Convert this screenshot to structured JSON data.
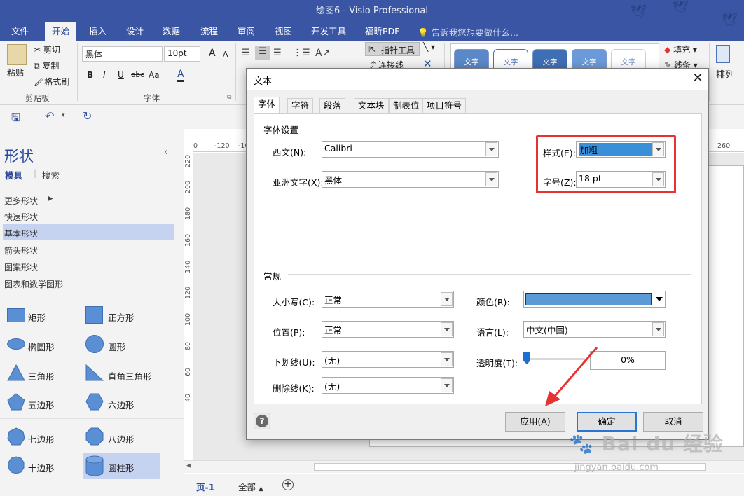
{
  "window": {
    "title": "绘图6 - Visio Professional"
  },
  "ribbon_tabs": [
    "文件",
    "开始",
    "插入",
    "设计",
    "数据",
    "流程",
    "审阅",
    "视图",
    "开发工具",
    "福昕PDF"
  ],
  "active_ribbon_tab": "开始",
  "tell_me": "告诉我您想要做什么...",
  "ribbon": {
    "paste": "粘贴",
    "cut": "剪切",
    "copy": "复制",
    "format_painter": "格式刷",
    "clipboard_label": "剪贴板",
    "font_name": "黑体",
    "font_size": "10pt",
    "grow": "A",
    "shrink": "A",
    "bold": "B",
    "italic": "I",
    "underline": "U",
    "strike": "abc",
    "case": "Aa",
    "font_color": "A",
    "font_label": "字体",
    "pointer_tool": "指针工具",
    "connector": "连接线",
    "style_sample": "文字",
    "fill": "填充",
    "line": "线条",
    "arrange": "排列"
  },
  "shapes_panel": {
    "title": "形状",
    "tab_stencils": "模具",
    "tab_search": "搜索",
    "links": [
      "更多形状",
      "快速形状",
      "基本形状",
      "箭头形状",
      "图案形状",
      "图表和数学图形"
    ],
    "selected_link": "基本形状",
    "items": [
      "矩形",
      "正方形",
      "椭圆形",
      "圆形",
      "三角形",
      "直角三角形",
      "五边形",
      "六边形",
      "七边形",
      "八边形",
      "十边形",
      "圆柱形"
    ],
    "shape_color": "#5b8fd4"
  },
  "ruler": {
    "top_ticks": [
      "0",
      "-120",
      "-10",
      "260"
    ],
    "left_ticks": [
      "220",
      "200",
      "180",
      "160",
      "140",
      "120",
      "100",
      "80",
      "60",
      "40"
    ]
  },
  "page_bar": {
    "page": "页-1",
    "all": "全部"
  },
  "dialog": {
    "title": "文本",
    "tabs": [
      "字体",
      "字符",
      "段落",
      "文本块",
      "制表位",
      "项目符号"
    ],
    "active_tab": "字体",
    "font_settings": {
      "section_title": "字体设置",
      "western_label": "西文(N):",
      "western_value": "Calibri",
      "asian_label": "亚洲文字(X):",
      "asian_value": "黑体",
      "style_label": "样式(E):",
      "style_value": "加粗",
      "size_label": "字号(Z):",
      "size_value": "18 pt"
    },
    "general": {
      "section_title": "常规",
      "case_label": "大小写(C):",
      "case_value": "正常",
      "position_label": "位置(P):",
      "position_value": "正常",
      "underline_label": "下划线(U):",
      "underline_value": "(无)",
      "strike_label": "删除线(K):",
      "strike_value": "(无)",
      "color_label": "颜色(R):",
      "color_value": "#5b9bd5",
      "language_label": "语言(L):",
      "language_value": "中文(中国)",
      "transparency_label": "透明度(T):",
      "transparency_value": "0%",
      "transparency_fraction": 0
    },
    "buttons": {
      "apply": "应用(A)",
      "ok": "确定",
      "cancel": "取消"
    }
  },
  "annotation": {
    "highlight_color": "#e53333"
  },
  "watermark": {
    "text": "Bai du 经验",
    "url": "jingyan.baidu.com"
  }
}
